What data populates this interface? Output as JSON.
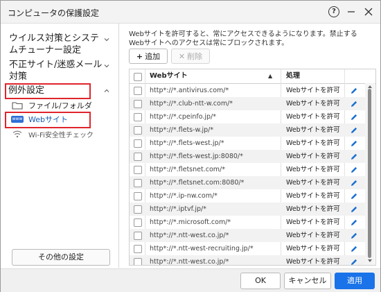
{
  "window": {
    "title": "コンピュータの保護設定",
    "help_symbol": "?"
  },
  "sidebar": {
    "sections": [
      {
        "label": "ウイルス対策とシステムチューナー設定"
      },
      {
        "label": "不正サイト/迷惑メール対策"
      },
      {
        "label": "例外設定"
      }
    ],
    "sub_items": [
      {
        "label": "ファイル/フォルダ",
        "icon": "folder-icon"
      },
      {
        "label": "Webサイト",
        "icon": "www-icon",
        "badge": "www"
      },
      {
        "label": "Wi-Fi安全性チェック",
        "icon": "wifi-icon"
      }
    ],
    "other_settings": "その他の設定"
  },
  "main": {
    "description": "Webサイトを許可すると、常にアクセスできるようになります。禁止するWebサイトへのアクセスは常にブロックされます。",
    "add_label": "追加",
    "delete_label": "削除",
    "table": {
      "col_site": "Webサイト",
      "col_action": "処理",
      "sort_indicator": "▲",
      "rows": [
        {
          "url": "http*://*.antivirus.com/*",
          "action": "Webサイトを許可"
        },
        {
          "url": "http*://*.club-ntt-w.com/*",
          "action": "Webサイトを許可"
        },
        {
          "url": "http*://*.cpeinfo.jp/*",
          "action": "Webサイトを許可"
        },
        {
          "url": "http*://*.flets-w.jp/*",
          "action": "Webサイトを許可"
        },
        {
          "url": "http*://*.flets-west.jp/*",
          "action": "Webサイトを許可"
        },
        {
          "url": "http*://*.flets-west.jp:8080/*",
          "action": "Webサイトを許可"
        },
        {
          "url": "http*://*.fletsnet.com/*",
          "action": "Webサイトを許可"
        },
        {
          "url": "http*://*.fletsnet.com:8080/*",
          "action": "Webサイトを許可"
        },
        {
          "url": "http*://*.ip-nw.com/*",
          "action": "Webサイトを許可"
        },
        {
          "url": "http*://*.iptvf.jp/*",
          "action": "Webサイトを許可"
        },
        {
          "url": "http*://*.microsoft.com/*",
          "action": "Webサイトを許可"
        },
        {
          "url": "http*://*.ntt-west.co.jp/*",
          "action": "Webサイトを許可"
        },
        {
          "url": "http*://*.ntt-west-recruiting.jp/*",
          "action": "Webサイトを許可"
        },
        {
          "url": "http*://*.ntt-west.co.jp/*",
          "action": "Webサイトを許可"
        }
      ]
    }
  },
  "footer": {
    "ok": "OK",
    "cancel": "キャンセル",
    "apply": "適用"
  },
  "colors": {
    "accent": "#1a73e8",
    "highlight": "#e0242b",
    "edit_icon": "#1a6fd0"
  }
}
